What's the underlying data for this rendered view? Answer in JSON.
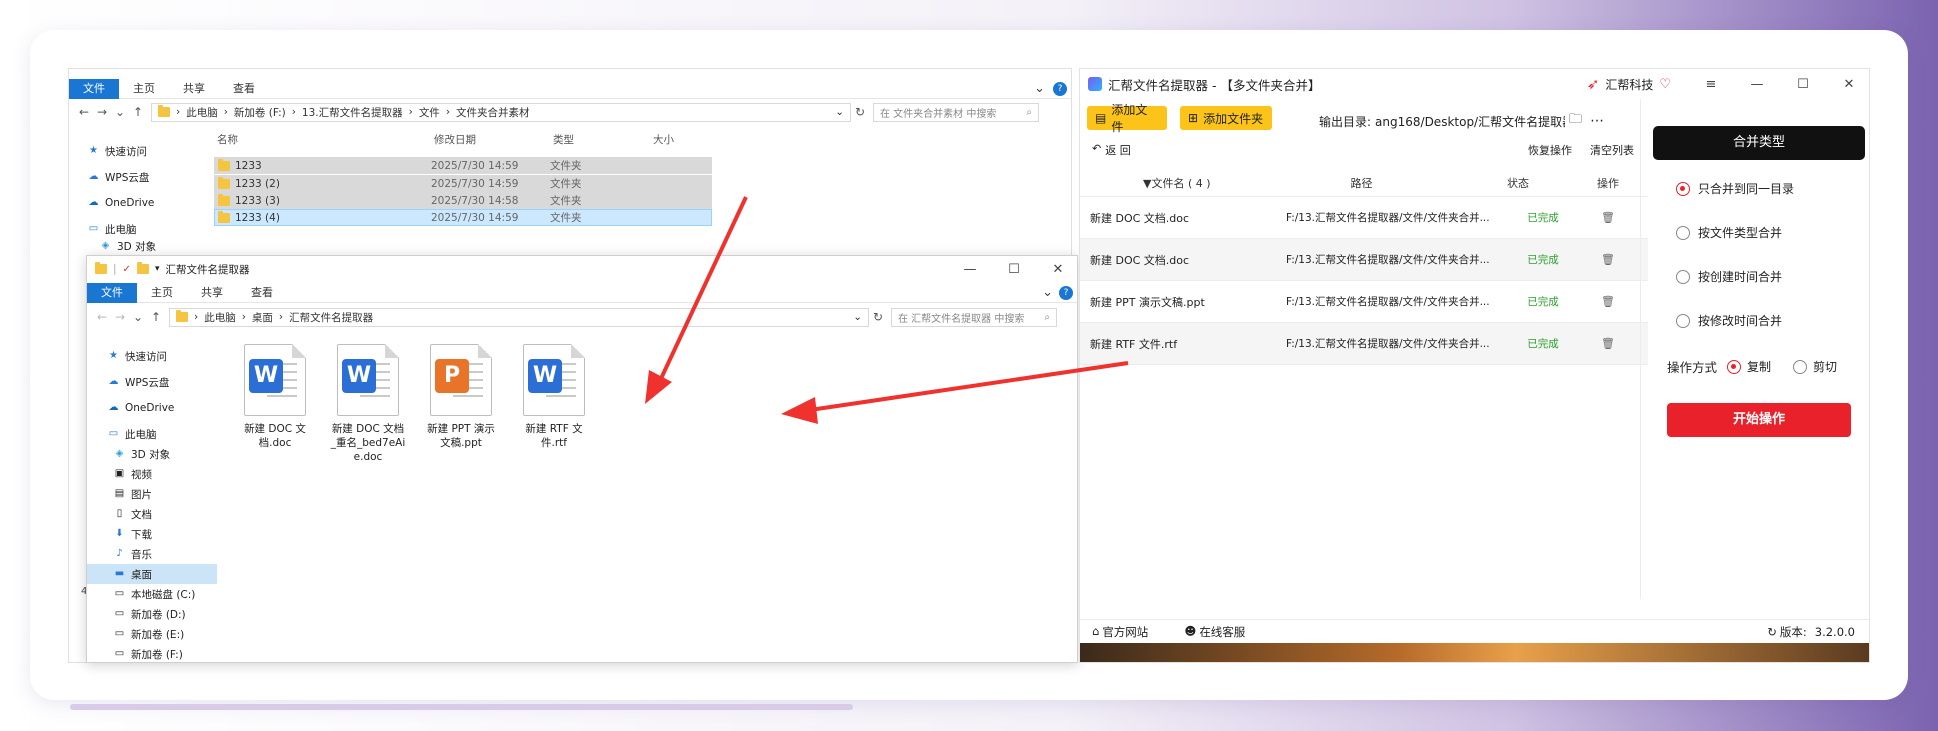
{
  "explorer_back": {
    "ribbon_tabs": [
      "文件",
      "主页",
      "共享",
      "查看"
    ],
    "breadcrumb": [
      "此电脑",
      "新加卷 (F:)",
      "13.汇帮文件名提取器",
      "文件",
      "文件夹合并素材"
    ],
    "search_placeholder": "在 文件夹合并素材 中搜索",
    "nav": [
      "快速访问",
      "WPS云盘",
      "OneDrive",
      "此电脑",
      "3D 对象"
    ],
    "columns": [
      "名称",
      "修改日期",
      "类型",
      "大小"
    ],
    "rows": [
      {
        "name": "1233",
        "date": "2025/7/30 14:59",
        "type": "文件夹"
      },
      {
        "name": "1233 (2)",
        "date": "2025/7/30 14:59",
        "type": "文件夹"
      },
      {
        "name": "1233 (3)",
        "date": "2025/7/30 14:58",
        "type": "文件夹"
      },
      {
        "name": "1233 (4)",
        "date": "2025/7/30 14:59",
        "type": "文件夹"
      }
    ],
    "status_count": "4"
  },
  "explorer_front": {
    "title": "汇帮文件名提取器",
    "ribbon_tabs": [
      "文件",
      "主页",
      "共享",
      "查看"
    ],
    "breadcrumb": [
      "此电脑",
      "桌面",
      "汇帮文件名提取器"
    ],
    "search_placeholder": "在 汇帮文件名提取器 中搜索",
    "nav": [
      "快速访问",
      "WPS云盘",
      "OneDrive",
      "此电脑",
      "3D 对象",
      "视频",
      "图片",
      "文档",
      "下载",
      "音乐",
      "桌面",
      "本地磁盘 (C:)",
      "新加卷 (D:)",
      "新加卷 (E:)",
      "新加卷 (F:)"
    ],
    "files": [
      {
        "kind": "W",
        "name": "新建 DOC 文档.doc"
      },
      {
        "kind": "W",
        "name": "新建 DOC 文档_重名_bed7eAie.doc"
      },
      {
        "kind": "P",
        "name": "新建 PPT 演示文稿.ppt"
      },
      {
        "kind": "W",
        "name": "新建 RTF 文件.rtf"
      }
    ]
  },
  "app": {
    "title": "汇帮文件名提取器 - 【多文件夹合并】",
    "brand": "汇帮科技",
    "add_file": "添加文件",
    "add_folder": "添加文件夹",
    "output_label": "输出目录:",
    "output_path": "ang168/Desktop/汇帮文件名提取器",
    "back": "返 回",
    "restore": "恢复操作",
    "clear": "清空列表",
    "col_name": "▼文件名 ( 4 )",
    "col_path": "路径",
    "col_status": "状态",
    "col_op": "操作",
    "rows": [
      {
        "name": "新建 DOC 文档.doc",
        "path": "F:/13.汇帮文件名提取器/文件/文件夹合并...",
        "status": "已完成"
      },
      {
        "name": "新建 DOC 文档.doc",
        "path": "F:/13.汇帮文件名提取器/文件/文件夹合并...",
        "status": "已完成"
      },
      {
        "name": "新建 PPT 演示文稿.ppt",
        "path": "F:/13.汇帮文件名提取器/文件/文件夹合并...",
        "status": "已完成"
      },
      {
        "name": "新建 RTF 文件.rtf",
        "path": "F:/13.汇帮文件名提取器/文件/文件夹合并...",
        "status": "已完成"
      }
    ],
    "merge_title": "合并类型",
    "merge_options": [
      "只合并到同一目录",
      "按文件类型合并",
      "按创建时间合并",
      "按修改时间合并"
    ],
    "merge_selected": 0,
    "op_label": "操作方式",
    "op_copy": "复制",
    "op_cut": "剪切",
    "start": "开始操作",
    "footer_site": "官方网站",
    "footer_service": "在线客服",
    "version_label": "版本:",
    "version": "3.2.0.0",
    "colors": {
      "accent": "#e8212b",
      "button_yellow": "#fcc419",
      "done": "#2ca02c",
      "ribbon_blue": "#1976d2"
    }
  }
}
